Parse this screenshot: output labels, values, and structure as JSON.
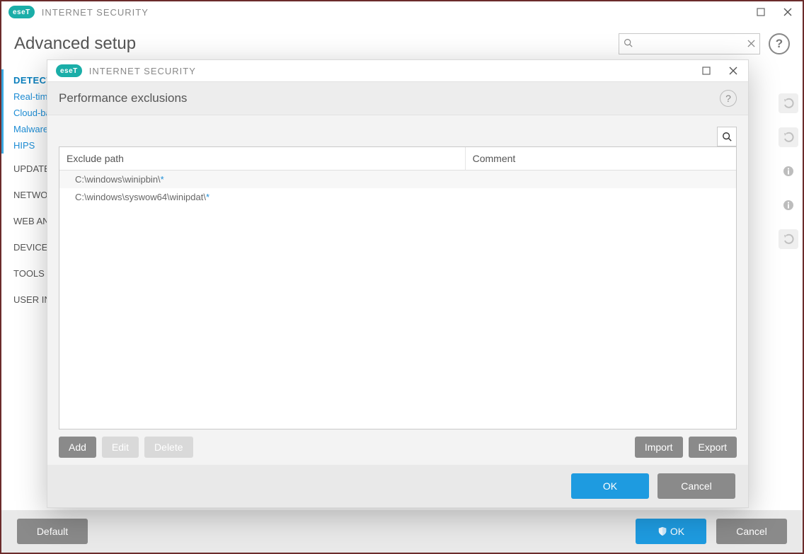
{
  "main": {
    "brand_badge": "eseT",
    "brand_product": "INTERNET SECURITY",
    "title": "Advanced setup",
    "search_placeholder": "",
    "sidebar": {
      "section": "DETECTION ENGINE",
      "items": [
        "Real-time file system protection",
        "Cloud-based protection",
        "Malware scans",
        "HIPS"
      ],
      "collapsed": [
        "UPDATE",
        "NETWORK PROTECTION",
        "WEB AND EMAIL",
        "DEVICE CONTROL",
        "TOOLS",
        "USER INTERFACE"
      ]
    },
    "footer": {
      "default": "Default",
      "ok": "OK",
      "cancel": "Cancel"
    }
  },
  "modal": {
    "brand_badge": "eseT",
    "brand_product": "INTERNET SECURITY",
    "title": "Performance exclusions",
    "columns": [
      "Exclude path",
      "Comment"
    ],
    "rows": [
      {
        "path": "C:\\windows\\winipbin\\",
        "wild": "*",
        "comment": ""
      },
      {
        "path": "C:\\windows\\syswow64\\winipdat\\",
        "wild": "*",
        "comment": ""
      }
    ],
    "buttons": {
      "add": "Add",
      "edit": "Edit",
      "delete": "Delete",
      "import": "Import",
      "export": "Export",
      "ok": "OK",
      "cancel": "Cancel"
    }
  }
}
